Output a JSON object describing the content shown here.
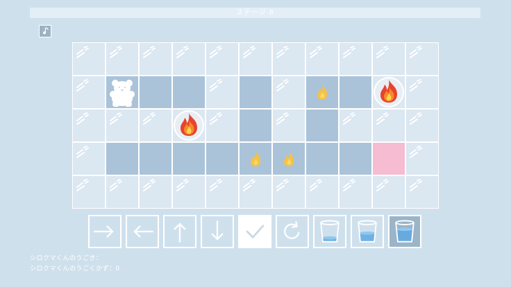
{
  "header": {
    "stage_title": "ステージ 8"
  },
  "toolbar": {
    "sound_icon": "music-note-icon"
  },
  "board": {
    "rows": 5,
    "cols": 11,
    "cells": [
      [
        "ice",
        "ice",
        "ice",
        "ice",
        "ice",
        "ice",
        "ice",
        "ice",
        "ice",
        "ice",
        "ice"
      ],
      [
        "ice",
        "bear",
        "path",
        "path",
        "ice",
        "path",
        "ice",
        "flame",
        "path",
        "bigfire",
        "ice"
      ],
      [
        "ice",
        "ice",
        "ice",
        "bigfire",
        "ice",
        "path",
        "ice",
        "path",
        "ice",
        "ice",
        "ice"
      ],
      [
        "ice",
        "path",
        "path",
        "path",
        "path",
        "flame",
        "flame",
        "path",
        "path",
        "goal",
        "ice"
      ],
      [
        "ice",
        "ice",
        "ice",
        "ice",
        "ice",
        "ice",
        "ice",
        "ice",
        "ice",
        "ice",
        "ice"
      ]
    ]
  },
  "controls": [
    {
      "id": "right",
      "icon": "arrow-right-icon"
    },
    {
      "id": "left",
      "icon": "arrow-left-icon"
    },
    {
      "id": "up",
      "icon": "arrow-up-icon"
    },
    {
      "id": "down",
      "icon": "arrow-down-icon"
    },
    {
      "id": "confirm",
      "icon": "check-icon",
      "selected": true
    },
    {
      "id": "reset",
      "icon": "rotate-icon"
    },
    {
      "id": "cup-small",
      "icon": "cup-low-water-icon",
      "water_level": 0.2
    },
    {
      "id": "cup-medium",
      "icon": "cup-medium-water-icon",
      "water_level": 0.45
    },
    {
      "id": "cup-large",
      "icon": "cup-full-water-icon",
      "water_level": 0.65,
      "selected": true
    }
  ],
  "status": {
    "moves_label": "シロクマくんのうごき：",
    "move_count_label": "シロクマくんのうごくかず：0"
  },
  "colors": {
    "background": "#cfe0ed",
    "ice_cell": "#dbe7f1",
    "path_cell": "#aac3d9",
    "goal_cell": "#f5bcd2",
    "water": "#5fa8e0"
  }
}
